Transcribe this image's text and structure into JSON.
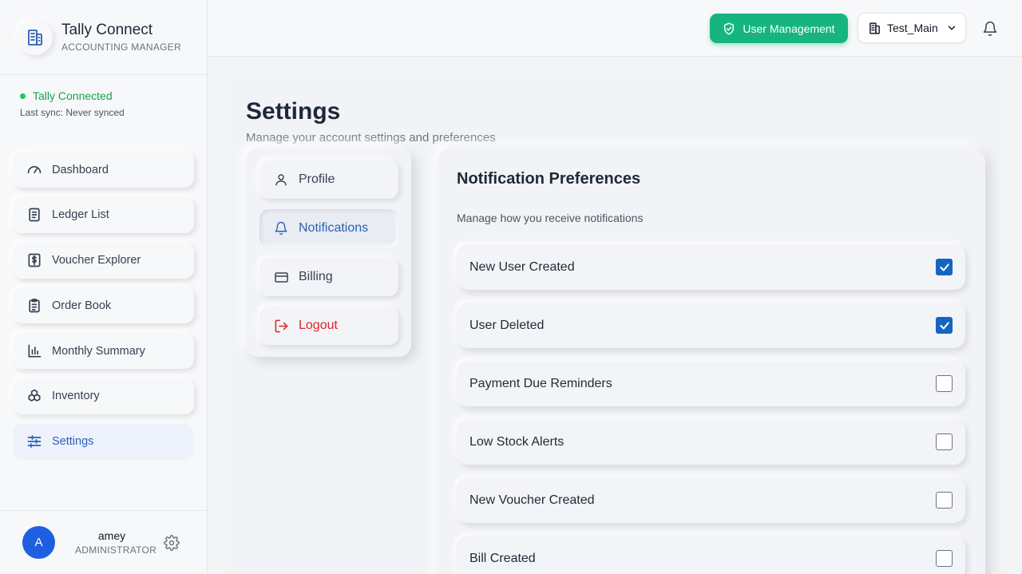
{
  "brand": {
    "title": "Tally Connect",
    "subtitle": "ACCOUNTING MANAGER"
  },
  "connection": {
    "status": "Tally Connected",
    "last_sync": "Last sync: Never synced",
    "status_color": "#16a34a"
  },
  "sidebar": {
    "items": [
      {
        "label": "Dashboard",
        "icon": "gauge-icon",
        "active": false
      },
      {
        "label": "Ledger List",
        "icon": "book-icon",
        "active": false
      },
      {
        "label": "Voucher Explorer",
        "icon": "dollar-receipt-icon",
        "active": false
      },
      {
        "label": "Order Book",
        "icon": "clipboard-icon",
        "active": false
      },
      {
        "label": "Monthly Summary",
        "icon": "bar-chart-icon",
        "active": false
      },
      {
        "label": "Inventory",
        "icon": "boxes-icon",
        "active": false
      },
      {
        "label": "Settings",
        "icon": "sliders-icon",
        "active": true
      }
    ]
  },
  "user": {
    "initial": "A",
    "name": "amey",
    "role": "ADMINISTRATOR"
  },
  "header": {
    "user_management_label": "User Management",
    "company_name": "Test_Main",
    "accent_color": "#16b57f"
  },
  "page": {
    "title": "Settings",
    "subtitle": "Manage your account settings and preferences"
  },
  "tabs": [
    {
      "label": "Profile",
      "icon": "user-icon",
      "active": false
    },
    {
      "label": "Notifications",
      "icon": "bell-icon",
      "active": true
    },
    {
      "label": "Billing",
      "icon": "credit-card-icon",
      "active": false
    },
    {
      "label": "Logout",
      "icon": "logout-icon",
      "active": false
    }
  ],
  "notifications": {
    "title": "Notification Preferences",
    "subtitle": "Manage how you receive notifications",
    "items": [
      {
        "label": "New User Created",
        "checked": true
      },
      {
        "label": "User Deleted",
        "checked": true
      },
      {
        "label": "Payment Due Reminders",
        "checked": false
      },
      {
        "label": "Low Stock Alerts",
        "checked": false
      },
      {
        "label": "New Voucher Created",
        "checked": false
      },
      {
        "label": "Bill Created",
        "checked": false
      }
    ]
  }
}
